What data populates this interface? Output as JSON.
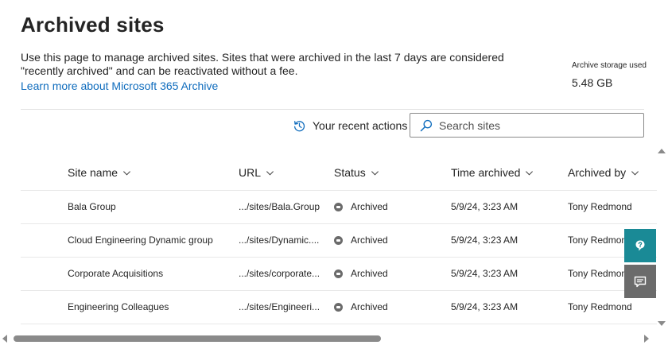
{
  "page": {
    "title": "Archived sites",
    "description": "Use this page to manage archived sites. Sites that were archived in the last 7 days are considered \"recently archived\" and can be reactivated without a fee.",
    "learn_more": "Learn more about Microsoft 365 Archive"
  },
  "storage": {
    "label": "Archive storage used",
    "value": "5.48 GB"
  },
  "toolbar": {
    "recent_actions": "Your recent actions",
    "search_placeholder": "Search sites"
  },
  "table": {
    "headers": {
      "site_name": "Site name",
      "url": "URL",
      "status": "Status",
      "time_archived": "Time archived",
      "archived_by": "Archived by"
    },
    "rows": [
      {
        "site_name": "Bala Group",
        "url": ".../sites/Bala.Group",
        "status": "Archived",
        "time_archived": "5/9/24, 3:23 AM",
        "archived_by": "Tony Redmond"
      },
      {
        "site_name": "Cloud Engineering Dynamic group",
        "url": ".../sites/Dynamic....",
        "status": "Archived",
        "time_archived": "5/9/24, 3:23 AM",
        "archived_by": "Tony Redmond"
      },
      {
        "site_name": "Corporate Acquisitions",
        "url": ".../sites/corporate...",
        "status": "Archived",
        "time_archived": "5/9/24, 3:23 AM",
        "archived_by": "Tony Redmond"
      },
      {
        "site_name": "Engineering Colleagues",
        "url": ".../sites/Engineeri...",
        "status": "Archived",
        "time_archived": "5/9/24, 3:23 AM",
        "archived_by": "Tony Redmond"
      }
    ]
  },
  "colors": {
    "link": "#0f6cbd",
    "help_button": "#1a8a96",
    "feedback_button": "#6b6b6b",
    "status_icon": "#6b6b6b"
  },
  "icons": {
    "recent_actions": "history-icon",
    "search": "search-icon",
    "sort": "chevron-down-icon",
    "status": "archived-status-icon",
    "help": "help-icon",
    "feedback": "feedback-icon"
  }
}
